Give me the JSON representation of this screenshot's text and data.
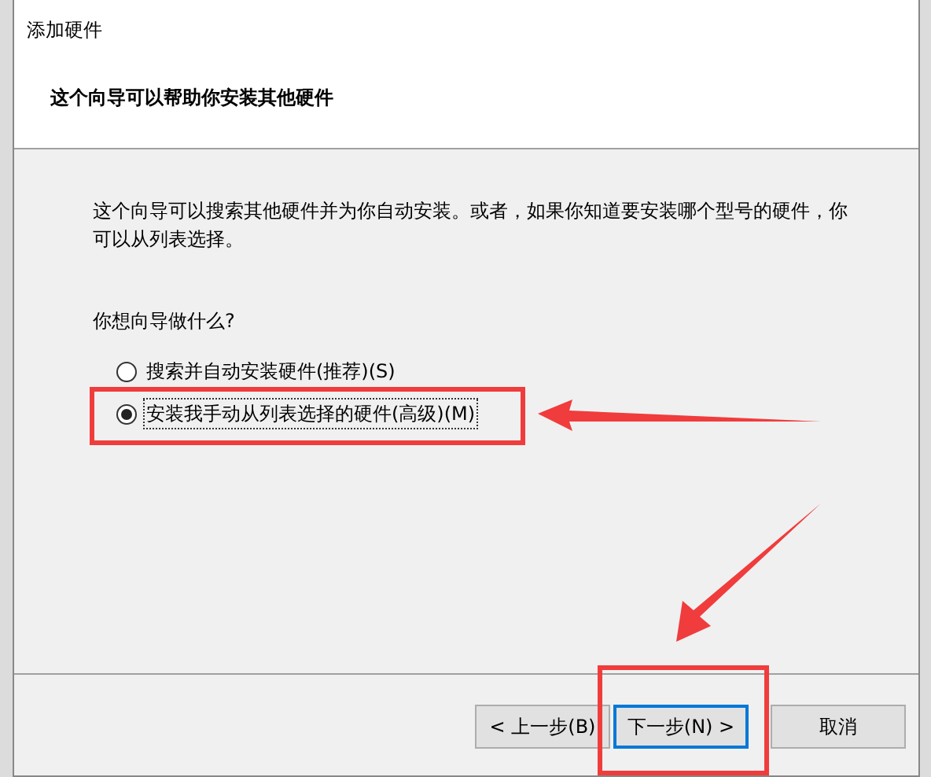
{
  "window": {
    "title": "添加硬件"
  },
  "header": {
    "subtitle": "这个向导可以帮助你安装其他硬件"
  },
  "intro": "这个向导可以搜索其他硬件并为你自动安装。或者，如果你知道要安装哪个型号的硬件，你可以从列表选择。",
  "question": "你想向导做什么?",
  "options": [
    {
      "label": "搜索并自动安装硬件(推荐)(S)",
      "selected": false,
      "highlighted": false
    },
    {
      "label": "安装我手动从列表选择的硬件(高级)(M)",
      "selected": true,
      "highlighted": true
    }
  ],
  "buttons": [
    {
      "label": "< 上一步(B)",
      "default": false,
      "highlighted": false
    },
    {
      "label": "下一步(N) >",
      "default": true,
      "highlighted": true
    },
    {
      "label": "取消",
      "default": false,
      "highlighted": false
    }
  ]
}
